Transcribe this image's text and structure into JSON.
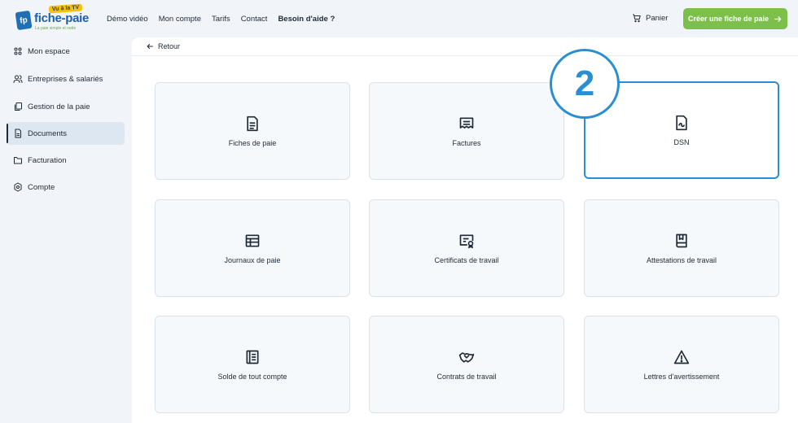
{
  "brand": {
    "fp": "fp",
    "name": "fiche-paie",
    "tv": "Vu à la TV",
    "tagline": "La paie simple et nette",
    "accent": "#7cc04b",
    "highlight": "#2a8fd0"
  },
  "nav": {
    "items": [
      "Démo vidéo",
      "Mon compte",
      "Tarifs",
      "Contact"
    ],
    "help": "Besoin d'aide ?"
  },
  "cart": {
    "label": "Panier"
  },
  "cta": {
    "label": "Créer une fiche de paie"
  },
  "sidebar": {
    "items": [
      {
        "label": "Mon espace",
        "icon": "grid-icon"
      },
      {
        "label": "Entreprises & salariés",
        "icon": "users-icon"
      },
      {
        "label": "Gestion de la paie",
        "icon": "copy-icon"
      },
      {
        "label": "Documents",
        "icon": "document-icon",
        "active": true
      },
      {
        "label": "Facturation",
        "icon": "folder-icon"
      },
      {
        "label": "Compte",
        "icon": "gear-icon"
      }
    ]
  },
  "main": {
    "back": "Retour",
    "cards": [
      {
        "label": "Fiches de paie",
        "icon": "document-lines-icon"
      },
      {
        "label": "Factures",
        "icon": "receipt-icon"
      },
      {
        "label": "DSN",
        "icon": "document-signature-icon",
        "highlighted": true
      },
      {
        "label": "Journaux de paie",
        "icon": "table-icon"
      },
      {
        "label": "Certificats de travail",
        "icon": "certificate-icon"
      },
      {
        "label": "Attestations de travail",
        "icon": "book-icon"
      },
      {
        "label": "Solde de tout compte",
        "icon": "list-document-icon"
      },
      {
        "label": "Contrats de travail",
        "icon": "handshake-icon"
      },
      {
        "label": "Lettres d'avertissement",
        "icon": "warning-icon"
      }
    ]
  },
  "step_badge": "2"
}
